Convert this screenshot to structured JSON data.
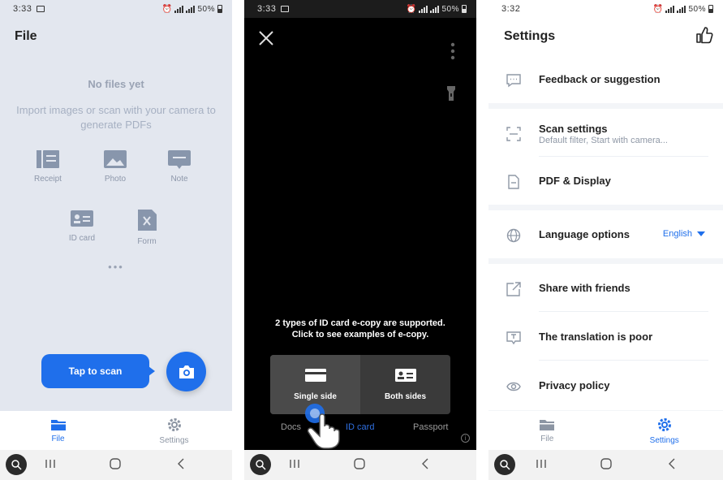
{
  "colors": {
    "accent": "#1f6feb",
    "panel1_bg": "#e3e7ef",
    "camera_bg": "#000000",
    "settings_bg": "#f3f5f8"
  },
  "panel1": {
    "status": {
      "time": "3:33",
      "battery": "50%"
    },
    "title": "File",
    "empty_title": "No files yet",
    "empty_sub": "Import images or scan with your camera to generate PDFs",
    "items": [
      {
        "label": "Receipt",
        "icon": "receipt-icon"
      },
      {
        "label": "Photo",
        "icon": "photo-icon"
      },
      {
        "label": "Note",
        "icon": "note-icon"
      },
      {
        "label": "ID card",
        "icon": "id-card-icon"
      },
      {
        "label": "Form",
        "icon": "form-icon"
      }
    ],
    "more": "•••",
    "tap_to_scan": "Tap to scan",
    "tabs": {
      "file": "File",
      "settings": "Settings"
    }
  },
  "panel2": {
    "status": {
      "time": "3:33",
      "battery": "50%"
    },
    "hint_line1": "2 types of ID card e-copy are supported.",
    "hint_line2": "Click to see examples of e-copy.",
    "choices": {
      "single": "Single side",
      "both": "Both sides"
    },
    "modes": {
      "docs": "Docs",
      "id_card": "ID card",
      "passport": "Passport"
    },
    "info": "i"
  },
  "panel3": {
    "status": {
      "time": "3:32",
      "battery": "50%"
    },
    "title": "Settings",
    "rows": {
      "feedback": "Feedback or suggestion",
      "scan_settings": "Scan settings",
      "scan_settings_sub": "Default filter, Start with camera...",
      "pdf_display": "PDF & Display",
      "language": "Language options",
      "language_value": "English",
      "share": "Share with friends",
      "translation": "The translation is poor",
      "privacy": "Privacy policy"
    },
    "tabs": {
      "file": "File",
      "settings": "Settings"
    }
  }
}
